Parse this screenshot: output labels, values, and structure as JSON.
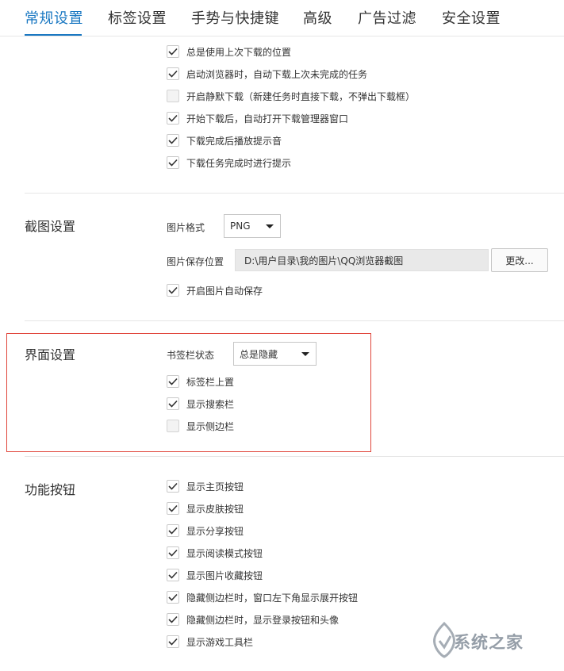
{
  "tabs": [
    {
      "label": "常规设置",
      "active": true
    },
    {
      "label": "标签设置",
      "active": false
    },
    {
      "label": "手势与快捷键",
      "active": false
    },
    {
      "label": "高级",
      "active": false
    },
    {
      "label": "广告过滤",
      "active": false
    },
    {
      "label": "安全设置",
      "active": false
    }
  ],
  "download": {
    "options": [
      {
        "label": "总是使用上次下载的位置",
        "checked": true
      },
      {
        "label": "启动浏览器时，自动下载上次未完成的任务",
        "checked": true
      },
      {
        "label": "开启静默下载（新建任务时直接下载，不弹出下载框）",
        "checked": false
      },
      {
        "label": "开始下载后，自动打开下载管理器窗口",
        "checked": true
      },
      {
        "label": "下载完成后播放提示音",
        "checked": true
      },
      {
        "label": "下载任务完成时进行提示",
        "checked": true
      }
    ]
  },
  "screenshot": {
    "title": "截图设置",
    "format_label": "图片格式",
    "format_value": "PNG",
    "save_location_label": "图片保存位置",
    "save_path": "D:\\用户目录\\我的图片\\QQ浏览器截图",
    "change_button": "更改...",
    "autosave": {
      "label": "开启图片自动保存",
      "checked": true
    }
  },
  "interface": {
    "title": "界面设置",
    "bookmark_bar_label": "书签栏状态",
    "bookmark_bar_value": "总是隐藏",
    "options": [
      {
        "label": "标签栏上置",
        "checked": true
      },
      {
        "label": "显示搜索栏",
        "checked": true
      },
      {
        "label": "显示侧边栏",
        "checked": false
      }
    ]
  },
  "buttons": {
    "title": "功能按钮",
    "options": [
      {
        "label": "显示主页按钮",
        "checked": true
      },
      {
        "label": "显示皮肤按钮",
        "checked": true
      },
      {
        "label": "显示分享按钮",
        "checked": true
      },
      {
        "label": "显示阅读模式按钮",
        "checked": true
      },
      {
        "label": "显示图片收藏按钮",
        "checked": true
      },
      {
        "label": "隐藏侧边栏时，窗口左下角显示展开按钮",
        "checked": true
      },
      {
        "label": "隐藏侧边栏时，显示登录按钮和头像",
        "checked": true
      },
      {
        "label": "显示游戏工具栏",
        "checked": true
      }
    ]
  },
  "watermark": {
    "text": "系统之家"
  },
  "colors": {
    "accent": "#1a78c2",
    "highlight_border": "#e0453b"
  }
}
